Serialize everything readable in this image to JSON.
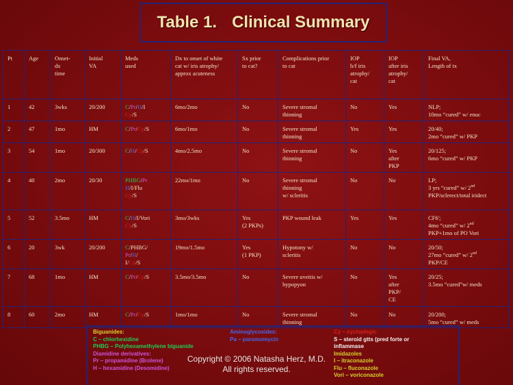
{
  "title": {
    "part1": "Table 1.",
    "part2": "Clinical Summary"
  },
  "table": {
    "headers": [
      "Pt",
      "Age",
      "Onset-\ndx\ntime",
      "Initial\nVA",
      "Meds\nused",
      "Dx to onset of white\ncat w/ iris atrophy/\napprox acuteness",
      "Sx prior\nto cat?",
      "Complications prior\nto cat",
      " IOP\nb/f iris\natrophy/\ncat",
      " IOP\nafter iris\natrophy/\ncat",
      "Final VA,\nLength of tx"
    ],
    "rows": [
      {
        "pt": "1",
        "age": "42",
        "onset": "3wks",
        "va": "20/200",
        "meds": [
          {
            "t": "C",
            "c": "g"
          },
          {
            "t": "/",
            "c": "w"
          },
          {
            "t": "Pr",
            "c": "p"
          },
          {
            "t": "/",
            "c": "w"
          },
          {
            "t": "H",
            "c": "b"
          },
          {
            "t": "/I",
            "c": "w"
          },
          {
            "t": "\n",
            "c": "w"
          },
          {
            "t": "Cy",
            "c": "r"
          },
          {
            "t": "/S",
            "c": "w"
          }
        ],
        "dx": "6mo/2mo",
        "sx": "No",
        "comp": "Severe stromal\nthinning",
        "iop_bf": "No",
        "iop_af": "Yes",
        "final": "NLP;\n10mo “cured” w/ enuc"
      },
      {
        "pt": "2",
        "age": "47",
        "onset": "1mo",
        "va": "HM",
        "meds": [
          {
            "t": "C",
            "c": "g"
          },
          {
            "t": "/",
            "c": "w"
          },
          {
            "t": "Pr",
            "c": "p"
          },
          {
            "t": "/",
            "c": "w"
          },
          {
            "t": "Cy",
            "c": "r"
          },
          {
            "t": "/S",
            "c": "w"
          }
        ],
        "dx": "6mo/1mo",
        "sx": "No",
        "comp": "Severe stromal\nthinning",
        "iop_bf": "Yes",
        "iop_af": "Yes",
        "final": "20/40;\n2mo “cured” w/ PKP"
      },
      {
        "pt": "3",
        "age": "54",
        "onset": "1mo",
        "va": "20/300",
        "meds": [
          {
            "t": "C",
            "c": "g"
          },
          {
            "t": "/",
            "c": "w"
          },
          {
            "t": "H",
            "c": "b"
          },
          {
            "t": "/",
            "c": "w"
          },
          {
            "t": "Cy",
            "c": "r"
          },
          {
            "t": "/S",
            "c": "w"
          }
        ],
        "dx": "4mo/2.5mo",
        "sx": "No",
        "comp": "Severe stromal\nthinning",
        "iop_bf": "No",
        "iop_af": "Yes\nafter\nPKP",
        "final": "20/125;\n6mo “cured” w/ PKP"
      },
      {
        "pt": "4",
        "age": "40",
        "onset": "2mo",
        "va": "20/30",
        "meds": [
          {
            "t": "PHBG",
            "c": "g"
          },
          {
            "t": "/",
            "c": "w"
          },
          {
            "t": "Pr",
            "c": "p"
          },
          {
            "t": "\n",
            "c": "w"
          },
          {
            "t": "H",
            "c": "b"
          },
          {
            "t": "/I/Flu",
            "c": "w"
          },
          {
            "t": "\n",
            "c": "w"
          },
          {
            "t": "Cy",
            "c": "r"
          },
          {
            "t": "/S",
            "c": "w"
          }
        ],
        "dx": "22mo/1mo",
        "sx": "No",
        "comp": "Severe stromal\nthinning\nw/ scleritis",
        "iop_bf": "No",
        "iop_af": "No",
        "final": "LP;\n3 yrs “cured” w/ 2nd\nPKP/sclerect/total iridect"
      },
      {
        "pt": "5",
        "age": "52",
        "onset": "3.5mo",
        "va": "HM",
        "meds": [
          {
            "t": "C",
            "c": "g"
          },
          {
            "t": "/",
            "c": "w"
          },
          {
            "t": "H",
            "c": "b"
          },
          {
            "t": "/I/Vori",
            "c": "w"
          },
          {
            "t": "\n",
            "c": "w"
          },
          {
            "t": "Cy",
            "c": "r"
          },
          {
            "t": "/S",
            "c": "w"
          }
        ],
        "dx": "3mo/3wks",
        "sx": "Yes\n(2 PKPs)",
        "comp": "PKP wound leak",
        "iop_bf": "Yes",
        "iop_af": "Yes",
        "final": "CF6';\n4mo “cured” w/ 2nd\nPKP+1mo of PO Vori"
      },
      {
        "pt": "6",
        "age": "20",
        "onset": "3wk",
        "va": "20/200",
        "meds": [
          {
            "t": "C",
            "c": "g"
          },
          {
            "t": "/PHBG/",
            "c": "w"
          },
          {
            "t": "\n",
            "c": "w"
          },
          {
            "t": "Pr",
            "c": "p"
          },
          {
            "t": "/",
            "c": "w"
          },
          {
            "t": "H",
            "c": "b"
          },
          {
            "t": "/",
            "c": "w"
          },
          {
            "t": "\n",
            "c": "w"
          },
          {
            "t": "I/",
            "c": "w"
          },
          {
            "t": "Cy",
            "c": "r"
          },
          {
            "t": "/S",
            "c": "w"
          }
        ],
        "dx": "19mo/1.5mo",
        "sx": "Yes\n(1 PKP)",
        "comp": "Hypotony w/\nscleritis",
        "iop_bf": "No",
        "iop_af": "No",
        "final": "20/50;\n27mo “cured” w/ 2nd\nPKP/CE"
      },
      {
        "pt": "7",
        "age": "68",
        "onset": "1mo",
        "va": "HM",
        "meds": [
          {
            "t": "C",
            "c": "g"
          },
          {
            "t": "/",
            "c": "w"
          },
          {
            "t": "Pr",
            "c": "p"
          },
          {
            "t": "/",
            "c": "w"
          },
          {
            "t": "Cy",
            "c": "r"
          },
          {
            "t": "/S",
            "c": "w"
          }
        ],
        "dx": "3.5mo/3.5mo",
        "sx": "No",
        "comp": "Severe uveitis w/\nhypopyon",
        "iop_bf": "No",
        "iop_af": "Yes\nafter\nPKP/\nCE",
        "final": "20/25;\n3.5mo “cured”w/ meds"
      },
      {
        "pt": "8",
        "age": "60",
        "onset": "2mo",
        "va": "HM",
        "meds": [
          {
            "t": "C",
            "c": "g"
          },
          {
            "t": "/",
            "c": "w"
          },
          {
            "t": "Pr",
            "c": "p"
          },
          {
            "t": "/",
            "c": "w"
          },
          {
            "t": "Cy",
            "c": "r"
          },
          {
            "t": "/S",
            "c": "w"
          }
        ],
        "dx": "1mo/1mo",
        "sx": "No",
        "comp": "Severe stromal\nthinning",
        "iop_bf": "No",
        "iop_af": "No",
        "final": "20/200;\n5mo “cured” w/ meds"
      }
    ]
  },
  "legend": {
    "col1": [
      {
        "t": "Biguanides:",
        "c": "#d8d430"
      },
      {
        "t": "C – chlorhexidine",
        "c": "#22cc55"
      },
      {
        "t": "PHBG – Polyhexamethylene biguanide",
        "c": "#22cc55"
      },
      {
        "t": "Diamidine derivatives:",
        "c": "#cc55dd"
      },
      {
        "t": "Pr – propamidine (Brolene)",
        "c": "#cc55dd"
      },
      {
        "t": "H – hexamidine (Desomidine)",
        "c": "#cc55dd"
      }
    ],
    "col2": [
      {
        "t": "Aminoglycosides:",
        "c": "#4466ee"
      },
      {
        "t": "Pa – paromomycin",
        "c": "#4466ee"
      }
    ],
    "col3": [
      {
        "t": "Cy – cycloplegic",
        "c": "#dd2020"
      },
      {
        "t": "S – steroid gtts (pred forte or",
        "c": "#f2f2f2"
      },
      {
        "t": "inflammase",
        "c": "#f2f2f2"
      },
      {
        "t": "Imidazoles",
        "c": "#d8d430"
      },
      {
        "t": "I – itraconazole",
        "c": "#d8d430"
      },
      {
        "t": "Flu – fluconazole",
        "c": "#d8d430"
      },
      {
        "t": "Vori – voriconazole",
        "c": "#d8d430"
      }
    ]
  },
  "copyright": {
    "line1": "Copyright © 2006 Natasha Herz, M.D.",
    "line2": "All rights reserved."
  }
}
